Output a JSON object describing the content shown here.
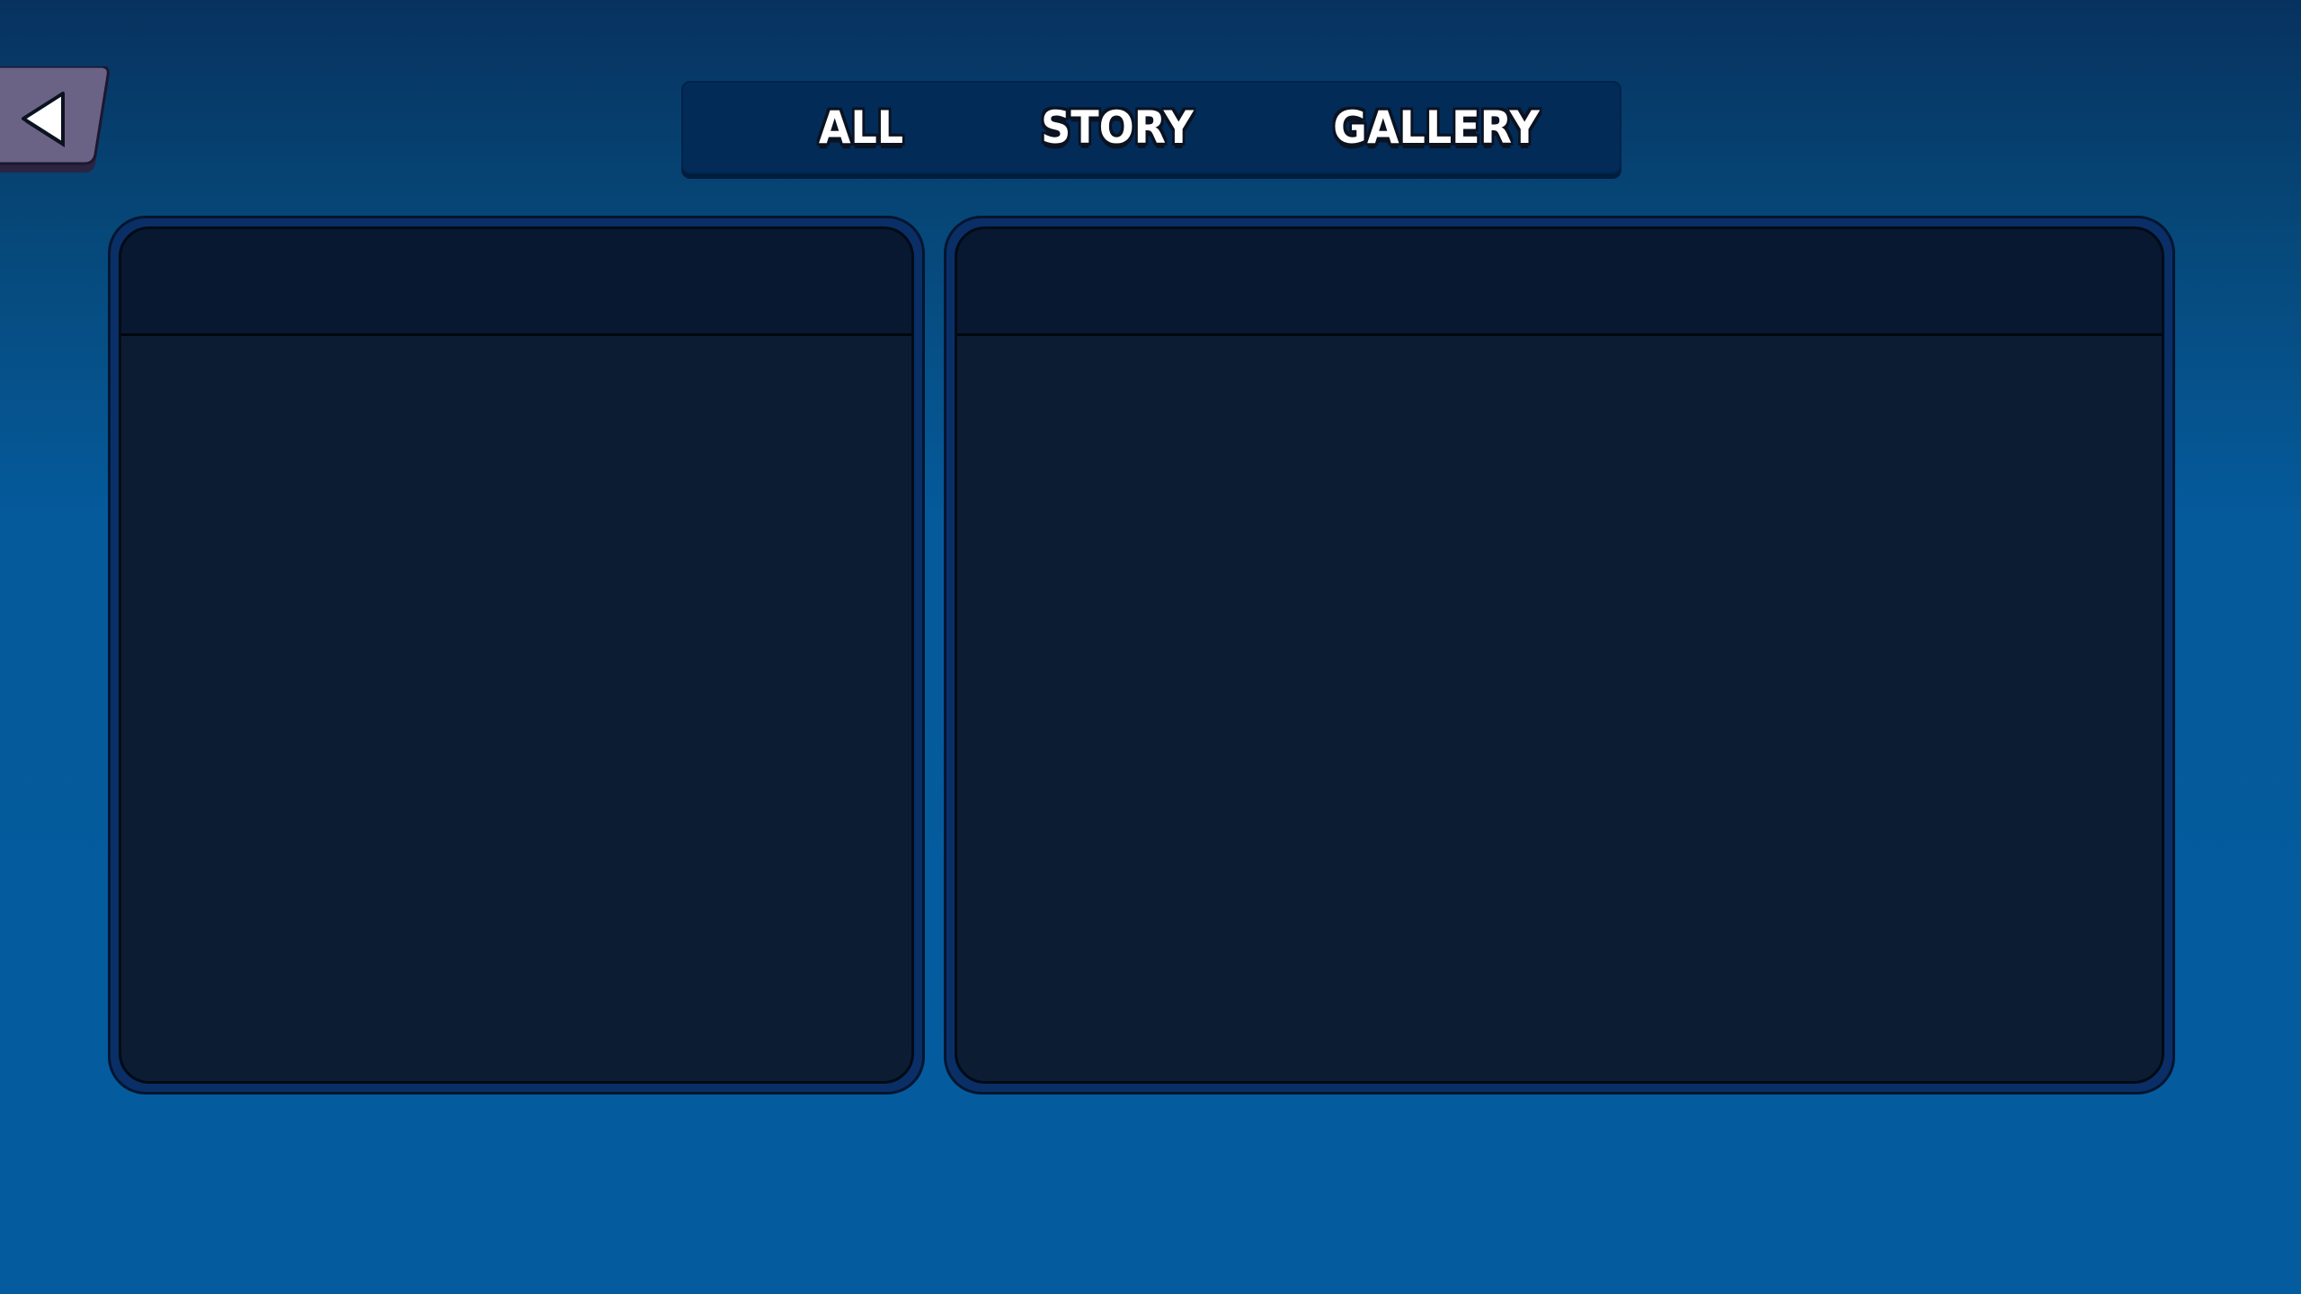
{
  "back_button": {
    "icon": "back-arrow-icon",
    "color": "#6b6385"
  },
  "tabs": [
    {
      "label": "ALL"
    },
    {
      "label": "STORY"
    },
    {
      "label": "GALLERY"
    }
  ],
  "colors": {
    "background_top": "#07325f",
    "background_bottom": "#045c9f",
    "tab_bar": "#022b58",
    "panel_body": "#0c1d33",
    "panel_header": "#081830",
    "panel_border": "#0a2f66"
  },
  "panels": {
    "left": {
      "header": ""
    },
    "right": {
      "header": ""
    }
  }
}
